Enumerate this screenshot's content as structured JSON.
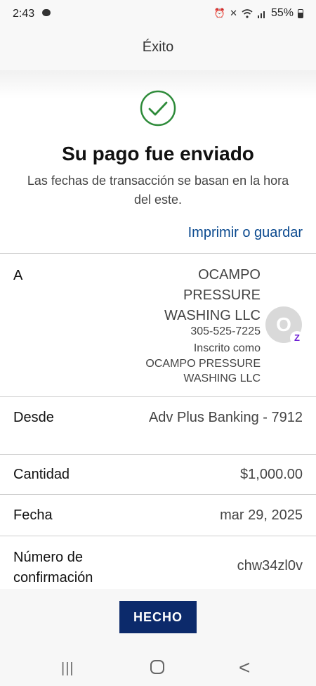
{
  "status_bar": {
    "time": "2:43",
    "battery": "55%",
    "icons": [
      "message-icon",
      "alarm-icon",
      "mute-icon",
      "wifi-icon",
      "signal-icon",
      "battery-icon"
    ]
  },
  "header": {
    "title": "Éxito"
  },
  "success": {
    "title": "Su pago fue enviado",
    "subtitle": "Las fechas de transacción se basan en la hora del este.",
    "print_link": "Imprimir o guardar",
    "check_color": "#2e8b3a"
  },
  "details": {
    "to": {
      "label": "A",
      "name": "OCAMPO PRESSURE WASHING LLC",
      "phone": "305-525-7225",
      "enrolled_as_label": "Inscrito como",
      "enrolled_name_line1": "OCAMPO PRESSURE",
      "enrolled_name_line2": "WASHING LLC",
      "avatar_initial": "O",
      "badge_glyph": "Z"
    },
    "from": {
      "label": "Desde",
      "value": "Adv Plus Banking - 7912"
    },
    "amount": {
      "label": "Cantidad",
      "value": "$1,000.00"
    },
    "date": {
      "label": "Fecha",
      "value": "mar 29, 2025"
    },
    "confirmation": {
      "label": "Número de confirmación",
      "value": "chw34zl0v"
    }
  },
  "actions": {
    "done_label": "HECHO",
    "done_color": "#0c2a6b"
  },
  "nav": {
    "recents": "|||",
    "back": "<"
  }
}
